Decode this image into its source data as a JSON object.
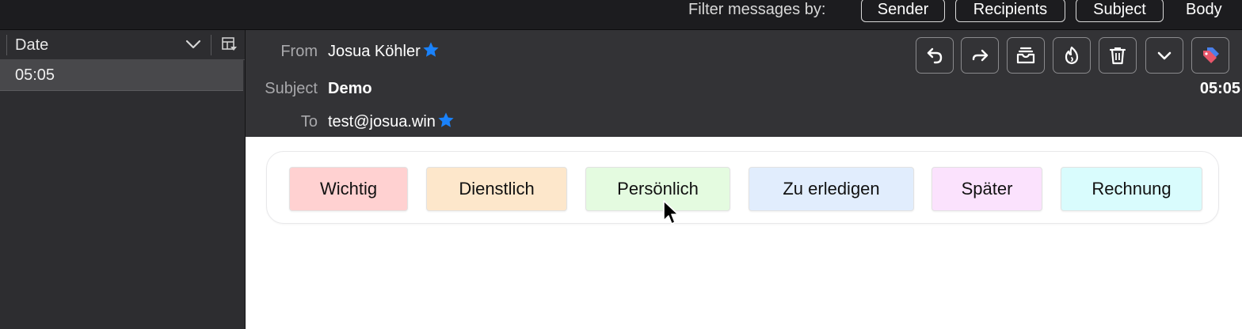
{
  "filter_bar": {
    "label": "Filter messages by:",
    "buttons": [
      "Sender",
      "Recipients",
      "Subject"
    ],
    "body_label": "Body"
  },
  "message_list": {
    "column_title": "Date",
    "rows": [
      {
        "time": "05:05"
      }
    ]
  },
  "header": {
    "from_label": "From",
    "from_value": "Josua Köhler",
    "subject_label": "Subject",
    "subject_value": "Demo",
    "to_label": "To",
    "to_value": "test@josua.win",
    "time": "05:05",
    "toolbar_icons": [
      "reply-icon",
      "forward-icon",
      "archive-icon",
      "junk-icon",
      "trash-icon",
      "more-icon",
      "tag-icon"
    ]
  },
  "tags": [
    {
      "label": "Wichtig",
      "color": "#ffd1d1"
    },
    {
      "label": "Dienstlich",
      "color": "#fde7cb"
    },
    {
      "label": "Persönlich",
      "color": "#e4fbe0"
    },
    {
      "label": "Zu erledigen",
      "color": "#e1edfd"
    },
    {
      "label": "Später",
      "color": "#fbe2fd"
    },
    {
      "label": "Rechnung",
      "color": "#d9fcfd"
    }
  ],
  "colors": {
    "star": "#1a82fb",
    "tag_icon_red": "#e8566a",
    "tag_icon_blue": "#4a7ee8"
  }
}
